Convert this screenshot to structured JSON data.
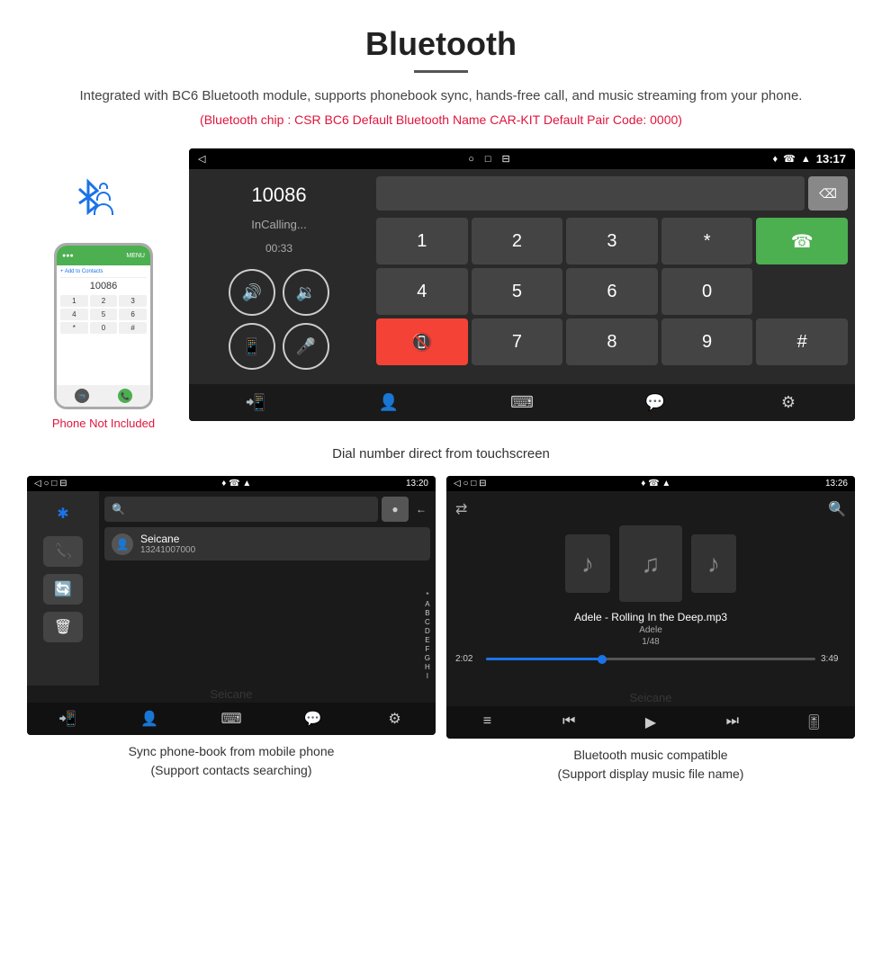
{
  "header": {
    "title": "Bluetooth",
    "description": "Integrated with BC6 Bluetooth module, supports phonebook sync, hands-free call, and music streaming from your phone.",
    "specs": "(Bluetooth chip : CSR BC6    Default Bluetooth Name CAR-KIT    Default Pair Code: 0000)"
  },
  "car_screen": {
    "status_bar": {
      "time": "13:17",
      "icons": "♦ ☎ ▲"
    },
    "phone_number": "10086",
    "calling_status": "InCalling...",
    "timer": "00:33",
    "dialpad": [
      "1",
      "2",
      "3",
      "*",
      "4",
      "5",
      "6",
      "0",
      "7",
      "8",
      "9",
      "#"
    ],
    "backspace": "⌫"
  },
  "caption_main": "Dial number direct from touchscreen",
  "phonebook_screen": {
    "status_bar_time": "13:20",
    "contact_name": "Seicane",
    "contact_phone": "13241007000",
    "search_placeholder": "Search",
    "alpha": [
      "*",
      "A",
      "B",
      "C",
      "D",
      "E",
      "F",
      "G",
      "H",
      "I"
    ]
  },
  "music_screen": {
    "status_bar_time": "13:26",
    "song_title": "Adele - Rolling In the Deep.mp3",
    "artist": "Adele",
    "track_info": "1/48",
    "time_current": "2:02",
    "time_total": "3:49"
  },
  "caption_phonebook": "Sync phone-book from mobile phone\n(Support contacts searching)",
  "caption_music": "Bluetooth music compatible\n(Support display music file name)",
  "phone_not_included": "Phone Not Included"
}
